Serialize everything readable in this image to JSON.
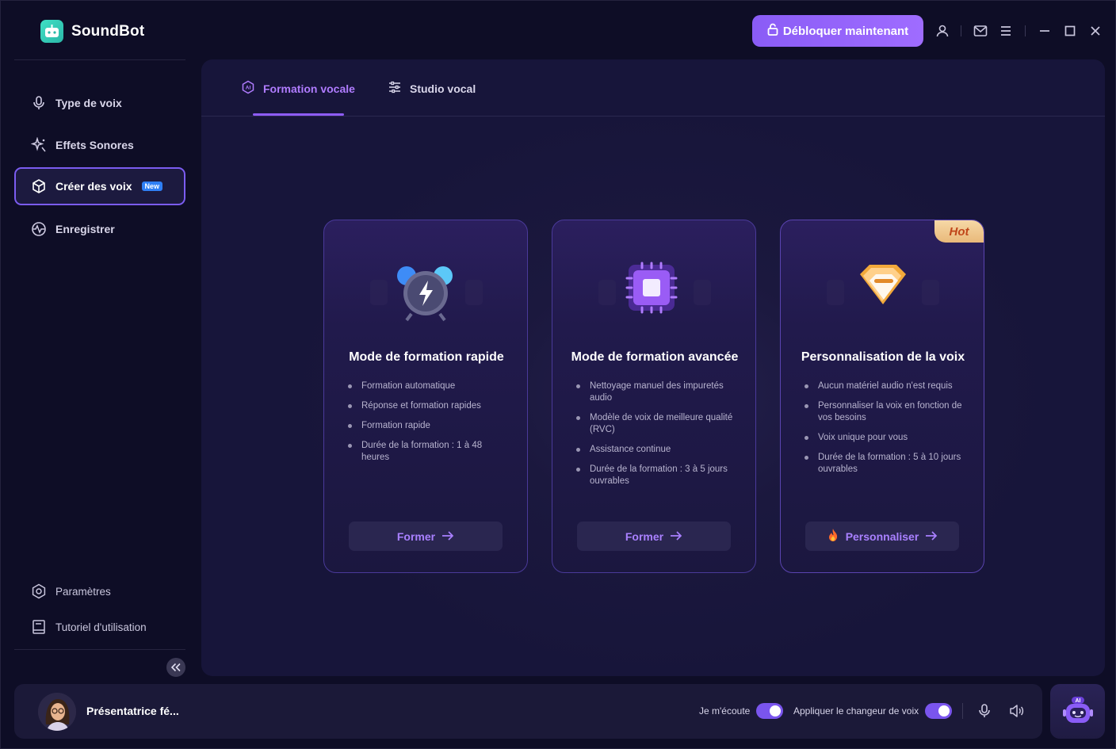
{
  "app": {
    "name": "SoundBot"
  },
  "titlebar": {
    "unlock_label": "Débloquer maintenant",
    "icons": [
      "user-icon",
      "mail-icon",
      "menu-icon",
      "minimize-icon",
      "maximize-icon",
      "close-icon"
    ]
  },
  "sidebar": {
    "items": [
      {
        "label": "Type de voix",
        "icon": "microphone-icon"
      },
      {
        "label": "Effets Sonores",
        "icon": "sparkle-icon"
      },
      {
        "label": "Créer des voix",
        "icon": "cube-icon",
        "badge": "New",
        "active": true
      },
      {
        "label": "Enregistrer",
        "icon": "waveform-icon"
      }
    ],
    "bottom_items": [
      {
        "label": "Paramètres",
        "icon": "settings-icon"
      },
      {
        "label": "Tutoriel d'utilisation",
        "icon": "book-icon"
      }
    ]
  },
  "tabs": [
    {
      "label": "Formation vocale",
      "icon": "ai-icon",
      "active": true
    },
    {
      "label": "Studio vocal",
      "icon": "sliders-icon",
      "active": false
    }
  ],
  "cards": [
    {
      "title": "Mode de formation rapide",
      "features": [
        "Formation automatique",
        "Réponse et formation rapides",
        "Formation rapide",
        "Durée de la formation : 1 à 48 heures"
      ],
      "button": "Former",
      "icon": "lightning-clock-icon"
    },
    {
      "title": "Mode de formation avancée",
      "features": [
        "Nettoyage manuel des impuretés audio",
        "Modèle de voix de meilleure qualité (RVC)",
        "Assistance continue",
        "Durée de la formation : 3 à 5 jours ouvrables"
      ],
      "button": "Former",
      "icon": "chip-icon"
    },
    {
      "title": "Personnalisation de la voix",
      "features": [
        "Aucun matériel audio n'est requis",
        "Personnaliser la voix en fonction de vos besoins",
        "Voix unique pour vous",
        "Durée de la formation : 5 à 10 jours ouvrables"
      ],
      "button": "Personnaliser",
      "badge": "Hot",
      "icon": "diamond-icon"
    }
  ],
  "bottom_bar": {
    "voice_name": "Présentatrice fé...",
    "listen_label": "Je m'écoute",
    "listen_on": true,
    "apply_label": "Appliquer le changeur de voix",
    "apply_on": true,
    "ai_label": "AI"
  },
  "colors": {
    "accent": "#8e5cf7",
    "background": "#0e0d26",
    "panel": "#1b183e",
    "hot_badge": "#e9b97a"
  }
}
